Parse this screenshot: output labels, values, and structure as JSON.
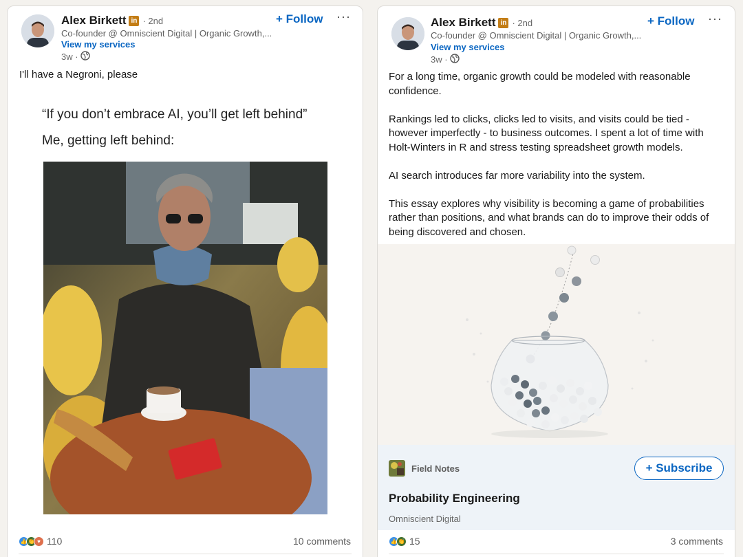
{
  "posts": [
    {
      "author": "Alex Birkett",
      "badge": "in",
      "degree": "· 2nd",
      "headline": "Co-founder @ Omniscient Digital | Organic Growth,...",
      "services_link": "View my services",
      "time": "3w ·",
      "visibility_icon": "globe-icon",
      "follow_label": "+ Follow",
      "more_label": "···",
      "text": [
        "I'll have a Negroni, please"
      ],
      "meme": {
        "line1": "“If you don’t embrace AI, you’ll get left behind”",
        "line2": "Me, getting left behind:"
      },
      "reaction_icons": [
        "like-icon",
        "celebrate-icon",
        "love-icon"
      ],
      "reaction_count": "110",
      "comments": "10 comments"
    },
    {
      "author": "Alex Birkett",
      "badge": "in",
      "degree": "· 2nd",
      "headline": "Co-founder @ Omniscient Digital | Organic Growth,...",
      "services_link": "View my services",
      "time": "3w ·",
      "visibility_icon": "globe-icon",
      "follow_label": "+ Follow",
      "more_label": "···",
      "text": [
        "For a long time, organic growth could be modeled with reasonable confidence.",
        "Rankings led to clicks, clicks led to visits, and visits could be tied - however imperfectly - to business outcomes. I spent a lot of time with Holt-Winters in R and stress testing spreadsheet growth models.",
        "AI search introduces far more variability into the system.",
        "This essay explores why visibility is becoming a game of probabilities rather than positions, and what brands can do to improve their odds of being discovered and chosen."
      ],
      "article": {
        "newsletter": "Field Notes",
        "subscribe_label": "+ Subscribe",
        "title": "Probability Engineering",
        "source": "Omniscient Digital"
      },
      "reaction_icons": [
        "like-icon",
        "celebrate-icon"
      ],
      "reaction_count": "15",
      "comments": "3 comments"
    }
  ],
  "colors": {
    "link_blue": "#0a66c2",
    "premium_gold": "#c37d16",
    "like_blue": "#378fe9",
    "celebrate_green": "#44712e",
    "love_red": "#df704d"
  }
}
